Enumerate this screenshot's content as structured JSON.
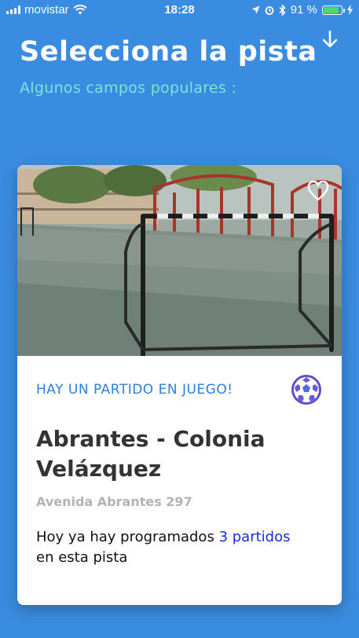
{
  "status_bar": {
    "carrier": "movistar",
    "time": "18:28",
    "battery_percent": "91 %",
    "battery_level": 0.91,
    "battery_color": "#4cd964"
  },
  "header": {
    "title": "Selecciona la pista",
    "subtitle": "Algunos campos populares :",
    "down_icon": "arrow-down-icon"
  },
  "card": {
    "live_label": "HAY UN PARTIDO EN JUEGO!",
    "name": "Abrantes - Colonia Velázquez",
    "address": "Avenida Abrantes 297",
    "matches_prefix": "Hoy ya hay programados",
    "matches_count": "3 partidos",
    "matches_suffix": "en esta pista",
    "favorite_icon": "heart-icon",
    "sport_icon": "soccer-ball-icon"
  },
  "colors": {
    "background": "#3a8ce0",
    "subtitle": "#7fe3d3",
    "live_label": "#2f7fd8",
    "link": "#1a2bd8"
  }
}
